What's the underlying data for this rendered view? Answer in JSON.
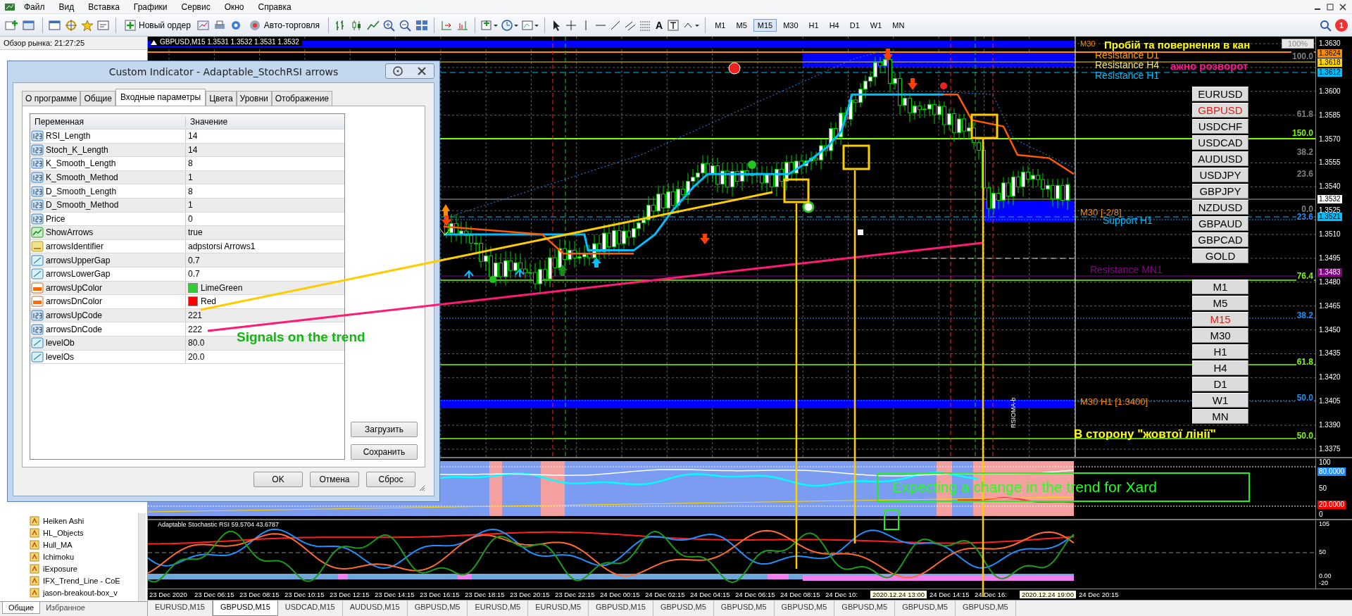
{
  "menu": [
    "Файл",
    "Вид",
    "Вставка",
    "Графики",
    "Сервис",
    "Окно",
    "Справка"
  ],
  "toolbar": {
    "new_order": "Новый ордер",
    "autotrading": "Авто-торговля",
    "text_tool": "A",
    "timeframes": [
      {
        "label": "M1",
        "selected": false
      },
      {
        "label": "M5",
        "selected": false
      },
      {
        "label": "M15",
        "selected": true
      },
      {
        "label": "M30",
        "selected": false
      },
      {
        "label": "H1",
        "selected": false
      },
      {
        "label": "H4",
        "selected": false
      },
      {
        "label": "D1",
        "selected": false
      },
      {
        "label": "W1",
        "selected": false
      },
      {
        "label": "MN",
        "selected": false
      }
    ],
    "notifications": "1"
  },
  "market_watch": {
    "title": "Обзор рынка: 21:27:25"
  },
  "navigator": {
    "items": [
      "Heiken Ashi",
      "HL_Objects",
      "Hull_MA",
      "Ichimoku",
      "iExposure",
      "IFX_Trend_Line - CoE",
      "jason-breakout-box_v"
    ],
    "tabs": [
      {
        "label": "Общие",
        "selected": true
      },
      {
        "label": "Избранное",
        "selected": false
      }
    ]
  },
  "chart": {
    "title": "GBPUSD,M15  1.3531 1.3532 1.3531 1.3532",
    "zoom": "100%",
    "labels": [
      {
        "text": "M30",
        "color": "#ff8c00"
      },
      {
        "text": "Пробій та повернення в кан",
        "color": "#ffff00"
      },
      {
        "text": "Resistance D1",
        "color": "#ffa500"
      },
      {
        "text": "Resistance H4",
        "color": "#f0e68c"
      },
      {
        "text": "ажно розворот",
        "color": "#ff1493"
      },
      {
        "text": "Resistance H1",
        "color": "#00bfff"
      },
      {
        "text": "M30 [-2/8]",
        "color": "#ff8c00"
      },
      {
        "text": "Support H1",
        "color": "#00bfff"
      },
      {
        "text": "Resistance MN1",
        "color": "#8b008b"
      },
      {
        "text": "M30 H1  [1.3400]",
        "color": "#ff8c00"
      },
      {
        "text": "В сторону \"жовтої лінії\"",
        "color": "#ffff00"
      },
      {
        "text": "RSIOMA-b",
        "color": "#ffffff"
      }
    ],
    "fib_levels": [
      {
        "text": "100.0",
        "color": "#808080"
      },
      {
        "text": "61.8",
        "color": "#808080"
      },
      {
        "text": "150.0",
        "color": "#7cfc00"
      },
      {
        "text": "38.2",
        "color": "#808080"
      },
      {
        "text": "23.6",
        "color": "#808080"
      },
      {
        "text": "0.0",
        "color": "#808080"
      },
      {
        "text": "23.6",
        "color": "#1e90ff"
      },
      {
        "text": "76.4",
        "color": "#7cfc00"
      },
      {
        "text": "38.2",
        "color": "#1e90ff"
      },
      {
        "text": "61.8",
        "color": "#7cfc00"
      },
      {
        "text": "50.0",
        "color": "#1e90ff"
      },
      {
        "text": "50.0",
        "color": "#7cfc00"
      }
    ],
    "price_ticks": [
      "1.3630",
      "1.3600",
      "1.3585",
      "1.3570",
      "1.3555",
      "1.3540",
      "1.3525",
      "1.3510",
      "1.3495",
      "1.3480",
      "1.3465",
      "1.3450",
      "1.3435",
      "1.3420",
      "1.3405",
      "1.3390",
      "1.3375"
    ],
    "price_tags": [
      {
        "text": "1.3624",
        "color": "#ff8c00"
      },
      {
        "text": "1.3618",
        "color": "#ffd700"
      },
      {
        "text": "1.3612",
        "color": "#00bfff"
      },
      {
        "text": "1.3532",
        "color": "#ffffff"
      },
      {
        "text": "1.3521",
        "color": "#00bfff"
      },
      {
        "text": "1.3483",
        "color": "#800080"
      }
    ],
    "symbol_buttons": [
      {
        "label": "EURUSD",
        "selected": false
      },
      {
        "label": "GBPUSD",
        "selected": true
      },
      {
        "label": "USDCHF",
        "selected": false
      },
      {
        "label": "USDCAD",
        "selected": false
      },
      {
        "label": "AUDUSD",
        "selected": false
      },
      {
        "label": "USDJPY",
        "selected": false
      },
      {
        "label": "GBPJPY",
        "selected": false
      },
      {
        "label": "NZDUSD",
        "selected": false
      },
      {
        "label": "GBPAUD",
        "selected": false
      },
      {
        "label": "GBPCAD",
        "selected": false
      },
      {
        "label": "GOLD",
        "selected": false
      }
    ],
    "timeframe_buttons": [
      {
        "label": "M1",
        "selected": false
      },
      {
        "label": "M5",
        "selected": false
      },
      {
        "label": "M15",
        "selected": true
      },
      {
        "label": "M30",
        "selected": false
      },
      {
        "label": "H1",
        "selected": false
      },
      {
        "label": "H4",
        "selected": false
      },
      {
        "label": "D1",
        "selected": false
      },
      {
        "label": "W1",
        "selected": false
      },
      {
        "label": "MN",
        "selected": false
      }
    ],
    "rsioma": {
      "ticks": [
        "100",
        "50",
        "0"
      ],
      "tags": [
        {
          "text": "80.0000",
          "color": "#1e90ff"
        },
        {
          "text": "20.0000",
          "color": "#ff0000"
        }
      ]
    },
    "stochastic": {
      "title": "Adaptable Stochastic RSI 59.5704 43.6787",
      "ticks": [
        "105",
        "50",
        "0.00",
        "-20"
      ]
    },
    "time_axis": [
      {
        "text": "23 Dec 2020",
        "kind": "tick"
      },
      {
        "text": "23 Dec 06:15",
        "kind": "tick"
      },
      {
        "text": "23 Dec 08:15",
        "kind": "tick"
      },
      {
        "text": "23 Dec 10:15",
        "kind": "tick"
      },
      {
        "text": "23 Dec 12:15",
        "kind": "tick"
      },
      {
        "text": "23 Dec 14:15",
        "kind": "tick"
      },
      {
        "text": "23 Dec 16:15",
        "kind": "tick"
      },
      {
        "text": "23 Dec 18:15",
        "kind": "tick"
      },
      {
        "text": "23 Dec 20:15",
        "kind": "tick"
      },
      {
        "text": "23 Dec 22:15",
        "kind": "tick"
      },
      {
        "text": "24 Dec 00:15",
        "kind": "tick"
      },
      {
        "text": "24 Dec 02:15",
        "kind": "tick"
      },
      {
        "text": "24 Dec 04:15",
        "kind": "tick"
      },
      {
        "text": "24 Dec 06:15",
        "kind": "tick"
      },
      {
        "text": "24 Dec 08:15",
        "kind": "tick"
      },
      {
        "text": "24 Dec 10:",
        "kind": "tick"
      },
      {
        "text": "2020.12.24 13:00",
        "kind": "tag"
      },
      {
        "text": "24 Dec 14:15",
        "kind": "tick"
      },
      {
        "text": "24 Dec 16:",
        "kind": "tick"
      },
      {
        "text": "2020.12.24 19:00",
        "kind": "tag"
      },
      {
        "text": "24 Dec 20:15",
        "kind": "tick"
      }
    ],
    "notes": {
      "signals": "Signals on the trend",
      "expecting": "Expecting a change in the trend for Xard"
    }
  },
  "dialog": {
    "title": "Custom Indicator - Adaptable_StochRSI arrows",
    "tabs": [
      {
        "label": "О программе",
        "selected": false
      },
      {
        "label": "Общие",
        "selected": false
      },
      {
        "label": "Входные параметры",
        "selected": true
      },
      {
        "label": "Цвета",
        "selected": false
      },
      {
        "label": "Уровни",
        "selected": false
      },
      {
        "label": "Отображение",
        "selected": false
      }
    ],
    "columns": [
      "Переменная",
      "Значение"
    ],
    "rows": [
      {
        "name": "RSI_Length",
        "value": "14",
        "kind": "int"
      },
      {
        "name": "Stoch_K_Length",
        "value": "14",
        "kind": "int"
      },
      {
        "name": "K_Smooth_Length",
        "value": "8",
        "kind": "int"
      },
      {
        "name": "K_Smooth_Method",
        "value": "1",
        "kind": "int"
      },
      {
        "name": "D_Smooth_Length",
        "value": "8",
        "kind": "int"
      },
      {
        "name": "D_Smooth_Method",
        "value": "1",
        "kind": "int"
      },
      {
        "name": "Price",
        "value": "0",
        "kind": "int"
      },
      {
        "name": "ShowArrows",
        "value": "true",
        "kind": "bool"
      },
      {
        "name": "arrowsIdentifier",
        "value": "adpstorsi Arrows1",
        "kind": "string"
      },
      {
        "name": "arrowsUpperGap",
        "value": "0.7",
        "kind": "double"
      },
      {
        "name": "arrowsLowerGap",
        "value": "0.7",
        "kind": "double"
      },
      {
        "name": "arrowsUpColor",
        "value": "LimeGreen",
        "kind": "color",
        "color": "#32cd32"
      },
      {
        "name": "arrowsDnColor",
        "value": "Red",
        "kind": "color",
        "color": "#ff0000"
      },
      {
        "name": "arrowsUpCode",
        "value": "221",
        "kind": "int"
      },
      {
        "name": "arrowsDnCode",
        "value": "222",
        "kind": "int"
      },
      {
        "name": "levelOb",
        "value": "80.0",
        "kind": "double"
      },
      {
        "name": "levelOs",
        "value": "20.0",
        "kind": "double"
      }
    ],
    "side_buttons": [
      "Загрузить",
      "Сохранить"
    ],
    "buttons": [
      "OK",
      "Отмена",
      "Сброс"
    ]
  },
  "chart_tabs": [
    {
      "label": "EURUSD,M15",
      "selected": false
    },
    {
      "label": "GBPUSD,M15",
      "selected": true
    },
    {
      "label": "USDCAD,M15",
      "selected": false
    },
    {
      "label": "AUDUSD,M15",
      "selected": false
    },
    {
      "label": "GBPUSD,M5",
      "selected": false
    },
    {
      "label": "EURUSD,M5",
      "selected": false
    },
    {
      "label": "EURUSD,M5",
      "selected": false
    },
    {
      "label": "GBPUSD,M15",
      "selected": false
    },
    {
      "label": "GBPUSD,M5",
      "selected": false
    },
    {
      "label": "GBPUSD,M5",
      "selected": false
    },
    {
      "label": "GBPUSD,M5",
      "selected": false
    },
    {
      "label": "GBPUSD,M5",
      "selected": false
    },
    {
      "label": "GBPUSD,M5",
      "selected": false
    },
    {
      "label": "GBPUSD,M5",
      "selected": false
    }
  ]
}
